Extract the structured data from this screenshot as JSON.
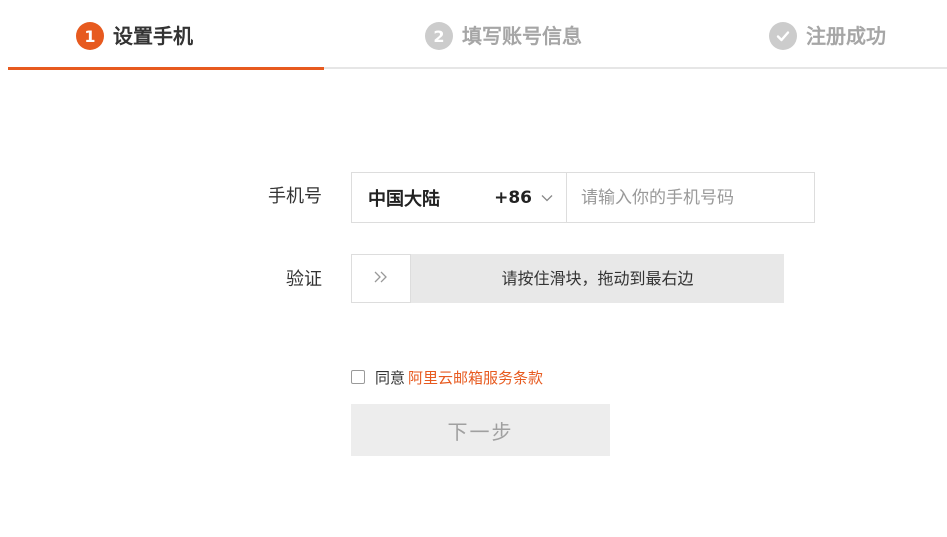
{
  "steps": [
    {
      "number": "1",
      "label": "设置手机",
      "state": "active"
    },
    {
      "number": "2",
      "label": "填写账号信息",
      "state": "inactive"
    },
    {
      "icon": "check-circle-icon",
      "label": "注册成功",
      "state": "inactive"
    }
  ],
  "form": {
    "phone_label": "手机号",
    "region_name": "中国大陆",
    "region_code": "+86",
    "phone_placeholder": "请输入你的手机号码",
    "phone_value": "",
    "verify_label": "验证",
    "slider_text": "请按住滑块，拖动到最右边",
    "slider_icon": "double-chevron-right-icon",
    "agree_text": "同意",
    "agree_link": "阿里云邮箱服务条款",
    "agree_checked": false,
    "next_label": "下一步"
  },
  "colors": {
    "accent": "#e75a1f",
    "inactive_step": "#cccccc",
    "disabled_button_bg": "#ededed",
    "slider_track_bg": "#e8e8e8"
  }
}
